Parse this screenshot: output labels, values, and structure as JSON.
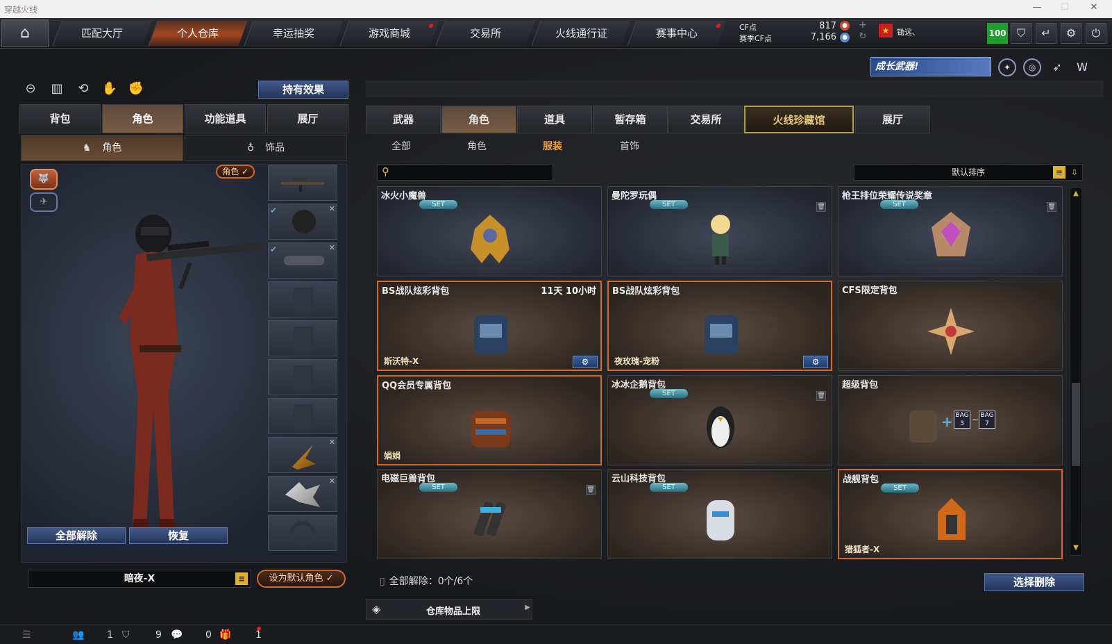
{
  "window": {
    "title": "穿越火线"
  },
  "topnav": {
    "tabs": [
      {
        "label": "匹配大厅"
      },
      {
        "label": "个人仓库"
      },
      {
        "label": "幸运抽奖"
      },
      {
        "label": "游戏商城"
      },
      {
        "label": "交易所"
      },
      {
        "label": "火线通行证"
      },
      {
        "label": "赛事中心"
      }
    ],
    "cf_label": "CF点",
    "cf_value": "817",
    "match_cf_label": "赛季CF点",
    "match_cf_value": "7,166",
    "player_name": "锄远、",
    "level": "100"
  },
  "banner": {
    "text": "成长武器!"
  },
  "left": {
    "hold_effect_button": "持有效果",
    "tabs": [
      "背包",
      "角色",
      "功能道具",
      "展厅"
    ],
    "subtabs": [
      "角色",
      "饰品"
    ],
    "role_badge": "角色 ✓",
    "release_all": "全部解除",
    "restore": "恢复",
    "default_role_name": "暗夜-X",
    "set_default_button": "设为默认角色 ✓"
  },
  "right": {
    "tabs": [
      "武器",
      "角色",
      "道具",
      "暂存箱",
      "交易所",
      "火线珍藏馆",
      "展厅"
    ],
    "filters": [
      "全部",
      "角色",
      "服装",
      "首饰"
    ],
    "sort_label": "默认排序",
    "cards": [
      {
        "name": "冰火小魔兽",
        "set": "SET",
        "time": "",
        "owner": ""
      },
      {
        "name": "曼陀罗玩偶",
        "set": "SET",
        "time": "",
        "owner": ""
      },
      {
        "name": "枪王排位荣耀传说奖章",
        "set": "SET",
        "time": "",
        "owner": ""
      },
      {
        "name": "BS战队炫彩背包",
        "set": "",
        "time": "11天 10小时",
        "owner": "斯沃特-X"
      },
      {
        "name": "BS战队炫彩背包",
        "set": "",
        "time": "",
        "owner": "夜玫瑰-宠粉"
      },
      {
        "name": "CFS限定背包",
        "set": "",
        "time": "",
        "owner": ""
      },
      {
        "name": "QQ会员专属背包",
        "set": "",
        "time": "",
        "owner": "娟娟"
      },
      {
        "name": "冰冰企鹅背包",
        "set": "SET",
        "time": "",
        "owner": ""
      },
      {
        "name": "超级背包",
        "set": "",
        "time": "",
        "owner": ""
      },
      {
        "name": "电磁巨兽背包",
        "set": "SET",
        "time": "",
        "owner": ""
      },
      {
        "name": "云山科技背包",
        "set": "SET",
        "time": "",
        "owner": ""
      },
      {
        "name": "战舰背包",
        "set": "SET",
        "time": "",
        "owner": "猎狐者-X"
      }
    ],
    "bag_labels": [
      "BAG 3",
      "BAG 7"
    ],
    "release_count": "全部解除：0个/6个",
    "select_delete": "选择删除",
    "storage_limit": "仓库物品上限"
  },
  "statusbar": {
    "v1": "1",
    "v2": "9",
    "v3": "0",
    "v4": "1"
  }
}
